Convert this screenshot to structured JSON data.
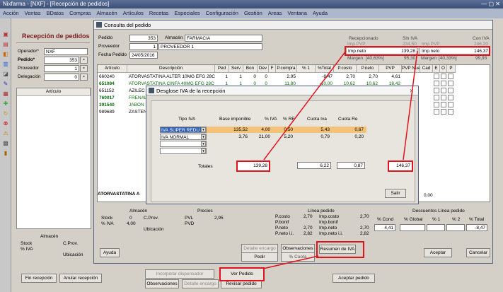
{
  "window_title": "Nixfarma - [NXF] - [Recepción de pedidos]",
  "menu": [
    "Acción",
    "Ventas",
    "BDatos",
    "Compras",
    "Almacén",
    "Artículos",
    "Recetas",
    "Especiales",
    "Configuración",
    "Gestión",
    "Areas",
    "Ventana",
    "Ayuda"
  ],
  "recepcion": {
    "title": "Recepción de pedidos",
    "operador_label": "Operador*",
    "operador_value": "NXF",
    "pedido_label": "Pedido*",
    "pedido_value": "353",
    "proveedor_label": "Proveedor",
    "proveedor_value": "1",
    "delegacion_label": "Delegación",
    "delegacion_value": "0",
    "articulo_header": "Artículo",
    "almacen_title": "Almacén",
    "stock_label": "Stock",
    "iva_label": "% IVA",
    "cprov_label": "C.Prov.",
    "ubicacion_label": "Ubicación",
    "buttons": {
      "fin": "Fin recepción",
      "anular": "Anular recepción",
      "incorporar": "Incorporar dispensador",
      "ver_pedido": "Ver Pedido",
      "observaciones": "Observaciones",
      "detalle": "Detalle encargo",
      "revisar": "Revisar pedido",
      "aceptar_pedido": "Aceptar pedido"
    }
  },
  "consulta": {
    "title": "Consulta del pedido",
    "pedido_label": "Pedido",
    "pedido_value": "353",
    "almacen_label": "Almacén",
    "almacen_value": "FARMACIA",
    "proveedor_label": "Proveedor",
    "proveedor_num": "1",
    "proveedor_name": "PROVEEDOR 1",
    "fecha_label": "Fecha Pedido",
    "fecha_value": "24/05/2016",
    "summary": {
      "recepcionado": "Recepcionado",
      "sin_iva": "Sin IVA",
      "con_iva": "Con IVA",
      "imp_pvp_label": "Imp.PVP",
      "imp_pvp_sin": "234,50",
      "imp_pvp_con": "246,20",
      "imp_neto_label": "Imp.neto",
      "imp_neto_sin": "139,28",
      "imp_neto_con": "146,37",
      "margen_label": "Margen",
      "margen_sin": "95,30",
      "margen_sin_pct": "[40,63%]",
      "margen_con": "99,93",
      "margen_con_pct": "[40,33%]"
    },
    "columns": [
      "Artículo",
      "Descripción",
      "Ped",
      "Serv",
      "Bon",
      "Dev",
      "F",
      "P.compra",
      "% 1",
      "%Total",
      "P.costo",
      "P.neto",
      "PVP",
      "PVP Nue",
      "Cad",
      "E",
      "O",
      "P"
    ],
    "rows": [
      {
        "code": "660240",
        "desc": "ATORVASTATINA ALTER 10MG EFG 28C",
        "ped": "1",
        "serv": "1",
        "bon": "0",
        "dev": "0",
        "pcompra": "2,95",
        "p1": "",
        "total": "-8,47",
        "pcosto": "2,70",
        "pneto": "2,70",
        "pvp": "4,61",
        "color": "#000"
      },
      {
        "code": "651084",
        "desc": "ATORVASTATINA CINFA 40MG EFG 28C",
        "ped": "1",
        "serv": "1",
        "bon": "0",
        "dev": "0",
        "pcompra": "11,80",
        "p1": "",
        "total": "-10,00",
        "pcosto": "10,62",
        "pneto": "10,62",
        "pvp": "18,42",
        "color": "#0a6b0a"
      },
      {
        "code": "651152",
        "desc": "AZILEC",
        "color": "#000"
      },
      {
        "code": "760017",
        "desc": "FRENAL",
        "color": "#0a6b0a"
      },
      {
        "code": "391540",
        "desc": "JABON",
        "color": "#0a6b0a"
      },
      {
        "code": "989689",
        "desc": "ZASTEN",
        "color": "#000"
      }
    ],
    "selected_desc": "ATORVASTATINA A",
    "almacen_title": "Almacén",
    "precios_title": "Precios",
    "stock_label": "Stock",
    "stock_value": "0",
    "iva_label": "% IVA",
    "iva_value": "4,00",
    "cprov_label": "C.Prov.",
    "ubicacion_label": "Ubicación",
    "pvl_label": "PVL",
    "pvl_value": "2,95",
    "pvd_label": "PVD",
    "linea_title": "Línea pedido",
    "linea": {
      "pcosto": "2,70",
      "impcosto": "2,70",
      "pbonif": "",
      "impbonif": "",
      "pneto": "2,70",
      "impneto": "2,70",
      "pnetoii": "2,82",
      "impnetoii": "2,82"
    },
    "linea_labels": {
      "pcosto": "P.costo",
      "impcosto": "Imp.costo",
      "pbonif": "P.bonif",
      "impbonif": "Imp.bonif",
      "pneto": "P.neto",
      "impneto": "Imp.neto",
      "pnetoii": "P.neto i.i.",
      "impnetoii": "Imp.neto i.i."
    },
    "desc_title": "Descuentos Línea pedido",
    "desc_labels": {
      "cond": "% Cond",
      "global": "% Global",
      "d1": "% 1",
      "d2": "% 2",
      "total": "% Total"
    },
    "desc_values": {
      "cond": "4,41",
      "total": "-8,47"
    },
    "misc_value": "0,00",
    "buttons": {
      "ayuda": "Ayuda",
      "detalle": "Detalle encargo",
      "observaciones": "Observaciones",
      "pedir": "Pedir",
      "resumen_iva": "Resumen de IVA",
      "borrar": "% Cuota",
      "aceptar": "Aceptar",
      "cancelar": "Cancelar"
    }
  },
  "desglose": {
    "title": "Desglose IVA de la recepción",
    "headers": [
      "Tipo IVA",
      "Base imponible",
      "% IVA",
      "% RE",
      "Cuota Iva",
      "Cuota Re"
    ],
    "rows": [
      {
        "tipo": "IVA SUPER REDU",
        "base": "135,52",
        "iva": "4,00",
        "re": "0,50",
        "cuota_iva": "5,43",
        "cuota_re": "0,67",
        "highlight": true
      },
      {
        "tipo": "IVA NORMAL",
        "base": "3,76",
        "iva": "21,00",
        "re": "5,20",
        "cuota_iva": "0,79",
        "cuota_re": "0,20",
        "highlight": false
      },
      {
        "tipo": "",
        "base": "",
        "iva": "",
        "re": "",
        "cuota_iva": "",
        "cuota_re": "",
        "highlight": false
      },
      {
        "tipo": "",
        "base": "",
        "iva": "",
        "re": "",
        "cuota_iva": "",
        "cuota_re": "",
        "highlight": false
      }
    ],
    "totales_label": "Totales",
    "total_base": "139,28",
    "total_cuota_iva": "6,22",
    "total_cuota_re": "0,87",
    "total_general": "146,37",
    "salir": "Salir"
  },
  "colors": {
    "highlight_row": "#f5c27a",
    "red": "#e0141e",
    "title_blue": "#3a4f76"
  }
}
